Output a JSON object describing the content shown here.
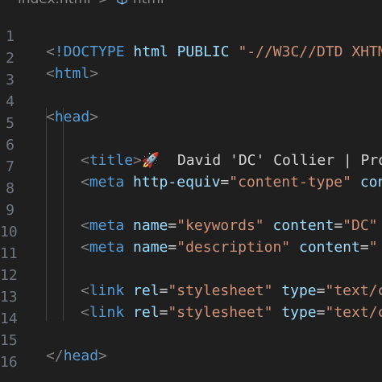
{
  "breadcrumb": {
    "file": "index.html",
    "separator": ">",
    "symbol": "html",
    "symbol_icon": "cube-icon"
  },
  "lines": [
    {
      "number": "1",
      "parts": {
        "open": "<",
        "tag": "!DOCTYPE",
        "space": " ",
        "rest": "html PUBLIC ",
        "str": "\"-//W3C//DTD XHTM"
      }
    },
    {
      "number": "2",
      "parts": {
        "open": "<",
        "tag": "html",
        "close": ">"
      }
    },
    {
      "number": "3"
    },
    {
      "number": "4",
      "parts": {
        "open": "<",
        "tag": "head",
        "close": ">"
      }
    },
    {
      "number": "5"
    },
    {
      "number": "6",
      "parts": {
        "open": "<",
        "tag": "title",
        "close": ">",
        "emoji": "🚀",
        "text": "  David 'DC' Collier | Pro"
      }
    },
    {
      "number": "7",
      "parts": {
        "open": "<",
        "tag": "meta",
        "a1": "http-equiv",
        "eq1": "=",
        "s1": "\"content-type\"",
        "a2": "con"
      }
    },
    {
      "number": "8"
    },
    {
      "number": "9",
      "parts": {
        "open": "<",
        "tag": "meta",
        "a1": "name",
        "eq1": "=",
        "s1": "\"keywords\"",
        "a2": "content",
        "eq2": "=",
        "s2": "\"DC\""
      }
    },
    {
      "number": "10",
      "parts": {
        "open": "<",
        "tag": "meta",
        "a1": "name",
        "eq1": "=",
        "s1": "\"description\"",
        "a2": "content",
        "eq2": "=",
        "s2": "\""
      }
    },
    {
      "number": "11"
    },
    {
      "number": "12",
      "parts": {
        "open": "<",
        "tag": "link",
        "a1": "rel",
        "eq1": "=",
        "s1": "\"stylesheet\"",
        "a2": "type",
        "eq2": "=",
        "s2": "\"text/c"
      }
    },
    {
      "number": "13",
      "parts": {
        "open": "<",
        "tag": "link",
        "a1": "rel",
        "eq1": "=",
        "s1": "\"stylesheet\"",
        "a2": "type",
        "eq2": "=",
        "s2": "\"text/c"
      }
    },
    {
      "number": "14"
    },
    {
      "number": "15",
      "parts": {
        "open": "</",
        "tag": "head",
        "close": ">"
      }
    },
    {
      "number": "16"
    }
  ],
  "colors": {
    "background": "#1f1f1f",
    "tag": "#569cd6",
    "attribute": "#9cdcfe",
    "string": "#ce9178",
    "punctuation": "#808080",
    "line_number": "#6e7681"
  }
}
